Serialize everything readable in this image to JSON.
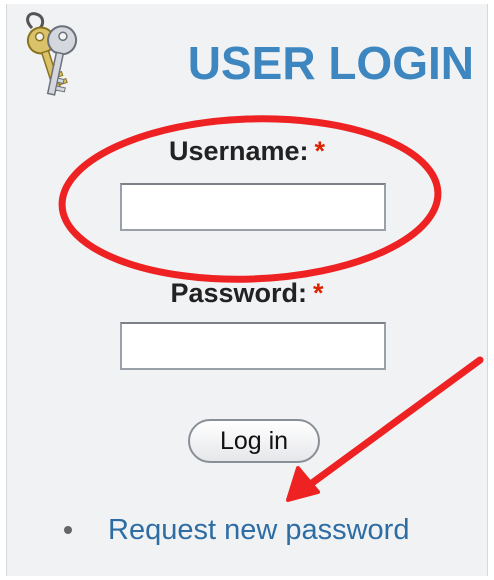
{
  "login_block": {
    "title": "USER LOGIN",
    "icon": "keys-icon",
    "username": {
      "label": "Username:",
      "required_mark": "*",
      "value": ""
    },
    "password": {
      "label": "Password:",
      "required_mark": "*",
      "value": ""
    },
    "submit_label": "Log in",
    "links": [
      {
        "label": "Request new password"
      }
    ]
  },
  "annotations": {
    "circle_target": "username-field",
    "arrow_target": "request-new-password-link",
    "color": "#ee2222"
  },
  "colors": {
    "title": "#3d86bf",
    "required": "#dd2200",
    "link": "#2e6da3",
    "panel_background": "#f1f2f4"
  }
}
